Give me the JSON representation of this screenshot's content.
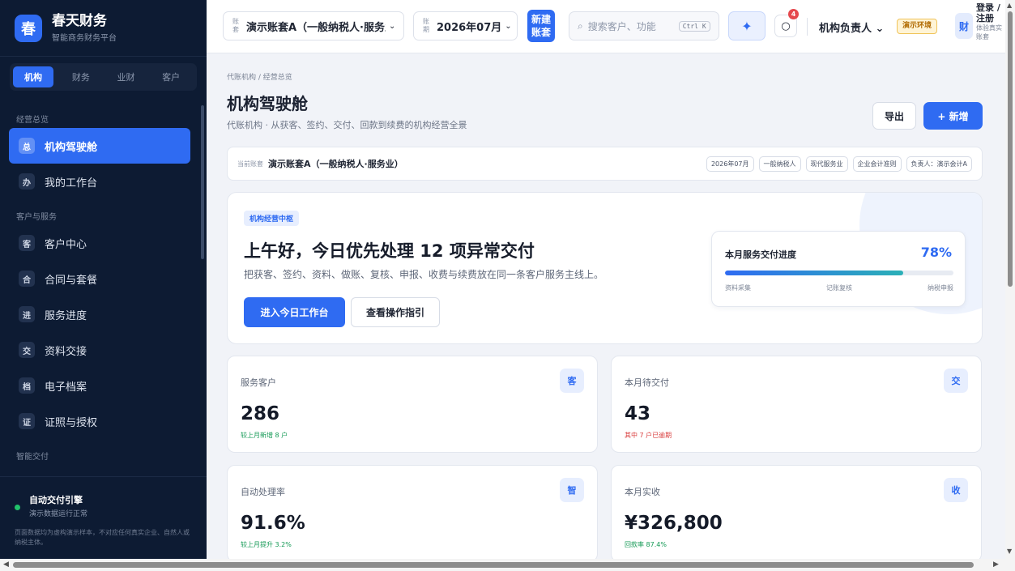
{
  "brand": {
    "logo_char": "春",
    "name": "春天财务",
    "subtitle": "智能商务财务平台"
  },
  "sidebar": {
    "tabs": [
      {
        "label": "机构",
        "active": true
      },
      {
        "label": "财务",
        "active": false
      },
      {
        "label": "业财",
        "active": false
      },
      {
        "label": "客户",
        "active": false
      }
    ],
    "groups": [
      {
        "label": "经营总览",
        "items": [
          {
            "icon": "总",
            "label": "机构驾驶舱",
            "active": true
          },
          {
            "icon": "办",
            "label": "我的工作台",
            "active": false
          }
        ]
      },
      {
        "label": "客户与服务",
        "items": [
          {
            "icon": "客",
            "label": "客户中心",
            "active": false
          },
          {
            "icon": "合",
            "label": "合同与套餐",
            "active": false
          },
          {
            "icon": "进",
            "label": "服务进度",
            "active": false
          },
          {
            "icon": "交",
            "label": "资料交接",
            "active": false
          },
          {
            "icon": "档",
            "label": "电子档案",
            "active": false
          },
          {
            "icon": "证",
            "label": "证照与授权",
            "active": false
          }
        ]
      },
      {
        "label": "智能交付",
        "items": []
      }
    ],
    "engine": {
      "title": "自动交付引擎",
      "status": "演示数据运行正常",
      "note": "页面数据均为虚构演示样本，不对应任何真实企业、自然人或纳税主体。",
      "status_color": "#21c26b"
    }
  },
  "topbar": {
    "account": {
      "mini_label": "账套",
      "value": "演示账套A（一般纳税人·服务业）",
      "chevron": "⌄"
    },
    "period": {
      "mini_label": "账期",
      "value": "2026年07月",
      "chevron": "⌄"
    },
    "new_account_label": "新建账套",
    "search": {
      "placeholder": "搜索客户、功能",
      "shortcut": "Ctrl K"
    },
    "ai_icon": "✦",
    "notification_count": "4",
    "role": "机构负责人",
    "role_chevron": "⌄",
    "env_badge": "演示环境",
    "avatar_char": "财",
    "login_label": "登录 / 注册",
    "login_sub": "体验真实账套"
  },
  "page": {
    "breadcrumb": "代账机构 / 经营总览",
    "title": "机构驾驶舱",
    "subtitle": "代账机构 · 从获客、签约、交付、回款到续费的机构经营全景",
    "export_label": "导出",
    "add_label": "+ 新增"
  },
  "account_bar": {
    "label": "当前账套",
    "value": "演示账套A（一般纳税人·服务业）",
    "tags": [
      "2026年07月",
      "一般纳税人",
      "现代服务业",
      "企业会计准则",
      "负责人：演示会计A"
    ]
  },
  "hero": {
    "tag": "机构经营中枢",
    "title": "上午好，今日优先处理 12 项异常交付",
    "desc": "把获客、签约、资料、做账、复核、申报、收费与续费放在同一条客户服务主线上。",
    "primary_label": "进入今日工作台",
    "secondary_label": "查看操作指引",
    "progress": {
      "title": "本月服务交付进度",
      "percent_label": "78%",
      "value": 0.78,
      "steps": [
        "资料采集",
        "记账复核",
        "纳税申报"
      ]
    }
  },
  "stats": [
    {
      "label": "服务客户",
      "icon": "客",
      "value": "286",
      "note": "较上月新增 8 户",
      "note_tone": "green"
    },
    {
      "label": "本月待交付",
      "icon": "交",
      "value": "43",
      "note": "其中 7 户已逾期",
      "note_tone": "red"
    },
    {
      "label": "自动处理率",
      "icon": "智",
      "value": "91.6%",
      "note": "较上月提升 3.2%",
      "note_tone": "green"
    },
    {
      "label": "本月实收",
      "icon": "收",
      "value": "¥326,800",
      "note": "回款率 87.4%",
      "note_tone": "green"
    }
  ],
  "colors": {
    "accent": "#2f6bf2",
    "sidebar_bg": "#0d1b33",
    "positive": "#159a56",
    "negative": "#d93d3d"
  }
}
